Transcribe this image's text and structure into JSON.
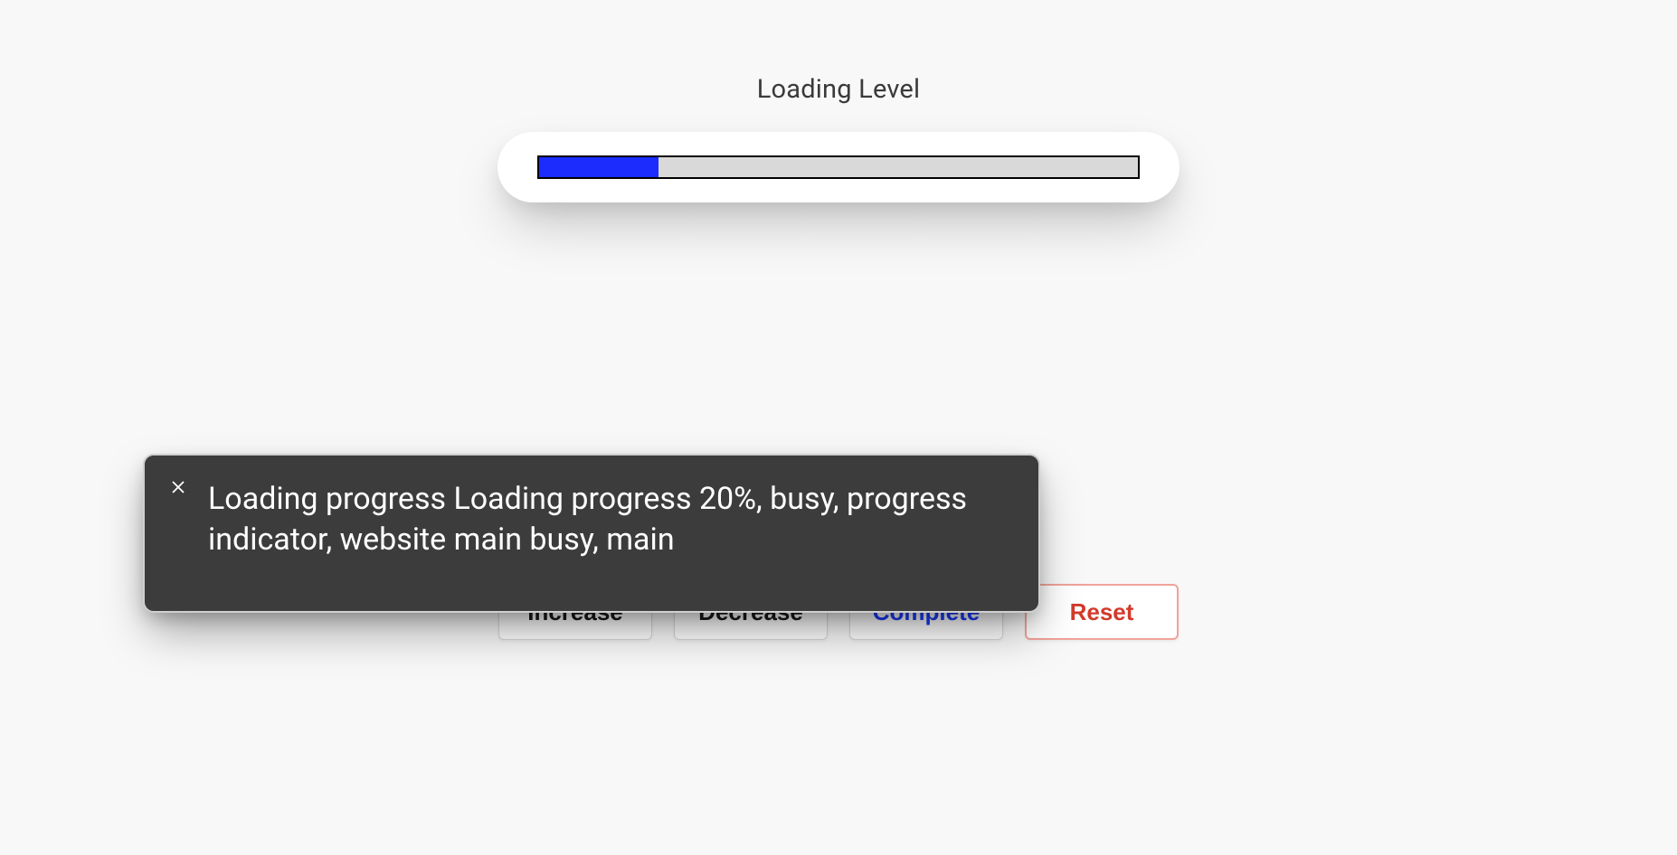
{
  "title": "Loading Level",
  "progress": {
    "percent": 20,
    "fill_color": "#1b2cfd",
    "track_color": "#d9d9d9"
  },
  "buttons": {
    "increase": "Increase",
    "decrease": "Decrease",
    "complete": "Complete",
    "reset": "Reset"
  },
  "toast": {
    "message": "Loading progress Loading progress 20%, busy, progress indicator, website main busy, main",
    "close_icon": "close"
  }
}
